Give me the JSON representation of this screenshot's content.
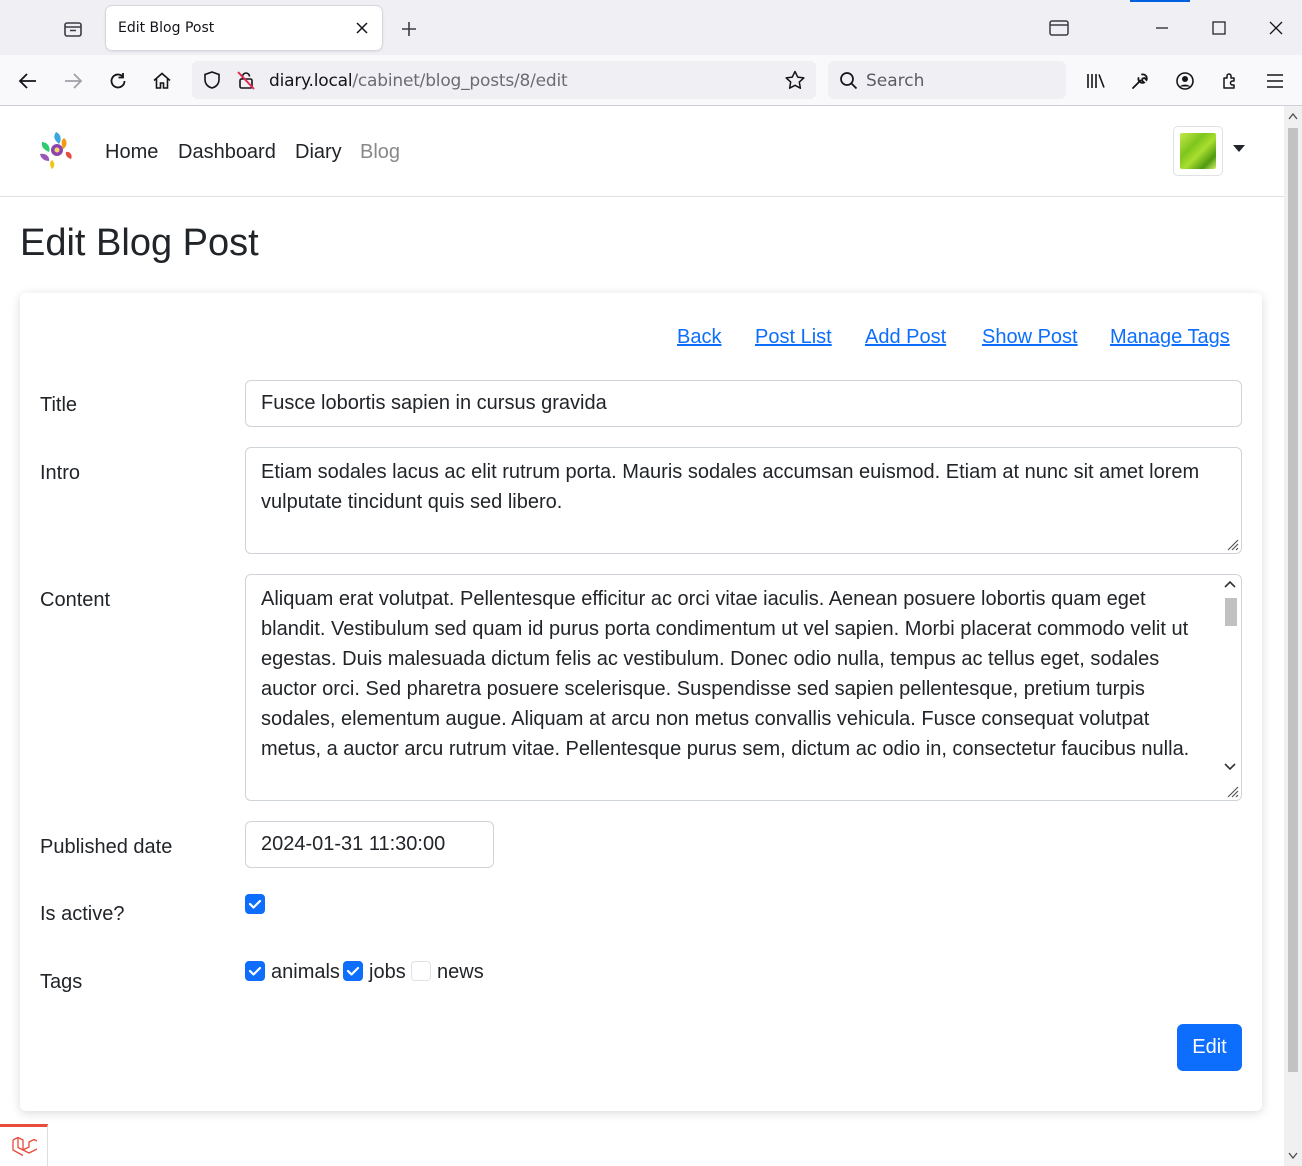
{
  "browser": {
    "tab_title": "Edit Blog Post",
    "url_host": "diary.local",
    "url_path": "/cabinet/blog_posts/8/edit",
    "search_placeholder": "Search"
  },
  "site_nav": {
    "links": [
      {
        "label": "Home",
        "active": false
      },
      {
        "label": "Dashboard",
        "active": false
      },
      {
        "label": "Diary",
        "active": false
      },
      {
        "label": "Blog",
        "active": true
      }
    ]
  },
  "page": {
    "title": "Edit Blog Post"
  },
  "card_links": [
    "Back",
    "Post List",
    "Add Post",
    "Show Post",
    "Manage Tags"
  ],
  "form": {
    "title_label": "Title",
    "title_value": "Fusce lobortis sapien in cursus gravida",
    "intro_label": "Intro",
    "intro_value": "Etiam sodales lacus ac elit rutrum porta. Mauris sodales accumsan euismod. Etiam at nunc sit amet lorem vulputate tincidunt quis sed libero.",
    "content_label": "Content",
    "content_value": "Aliquam erat volutpat. Pellentesque efficitur ac orci vitae iaculis. Aenean posuere lobortis quam eget blandit. Vestibulum sed quam id purus porta condimentum ut vel sapien. Morbi placerat commodo velit ut egestas. Duis malesuada dictum felis ac vestibulum. Donec odio nulla, tempus ac tellus eget, sodales auctor orci. Sed pharetra posuere scelerisque. Suspendisse sed sapien pellentesque, pretium turpis sodales, elementum augue. Aliquam at arcu non metus convallis vehicula. Fusce consequat volutpat metus, a auctor arcu rutrum vitae. Pellentesque purus sem, dictum ac odio in, consectetur faucibus nulla.",
    "published_label": "Published date",
    "published_value": "2024-01-31 11:30:00",
    "active_label": "Is active?",
    "active_checked": true,
    "tags_label": "Tags",
    "tags": [
      {
        "label": "animals",
        "checked": true
      },
      {
        "label": "jobs",
        "checked": true
      },
      {
        "label": "news",
        "checked": false
      }
    ],
    "submit_label": "Edit"
  },
  "colors": {
    "primary": "#0d6efd",
    "text": "#212529",
    "muted_link": "#888888"
  }
}
